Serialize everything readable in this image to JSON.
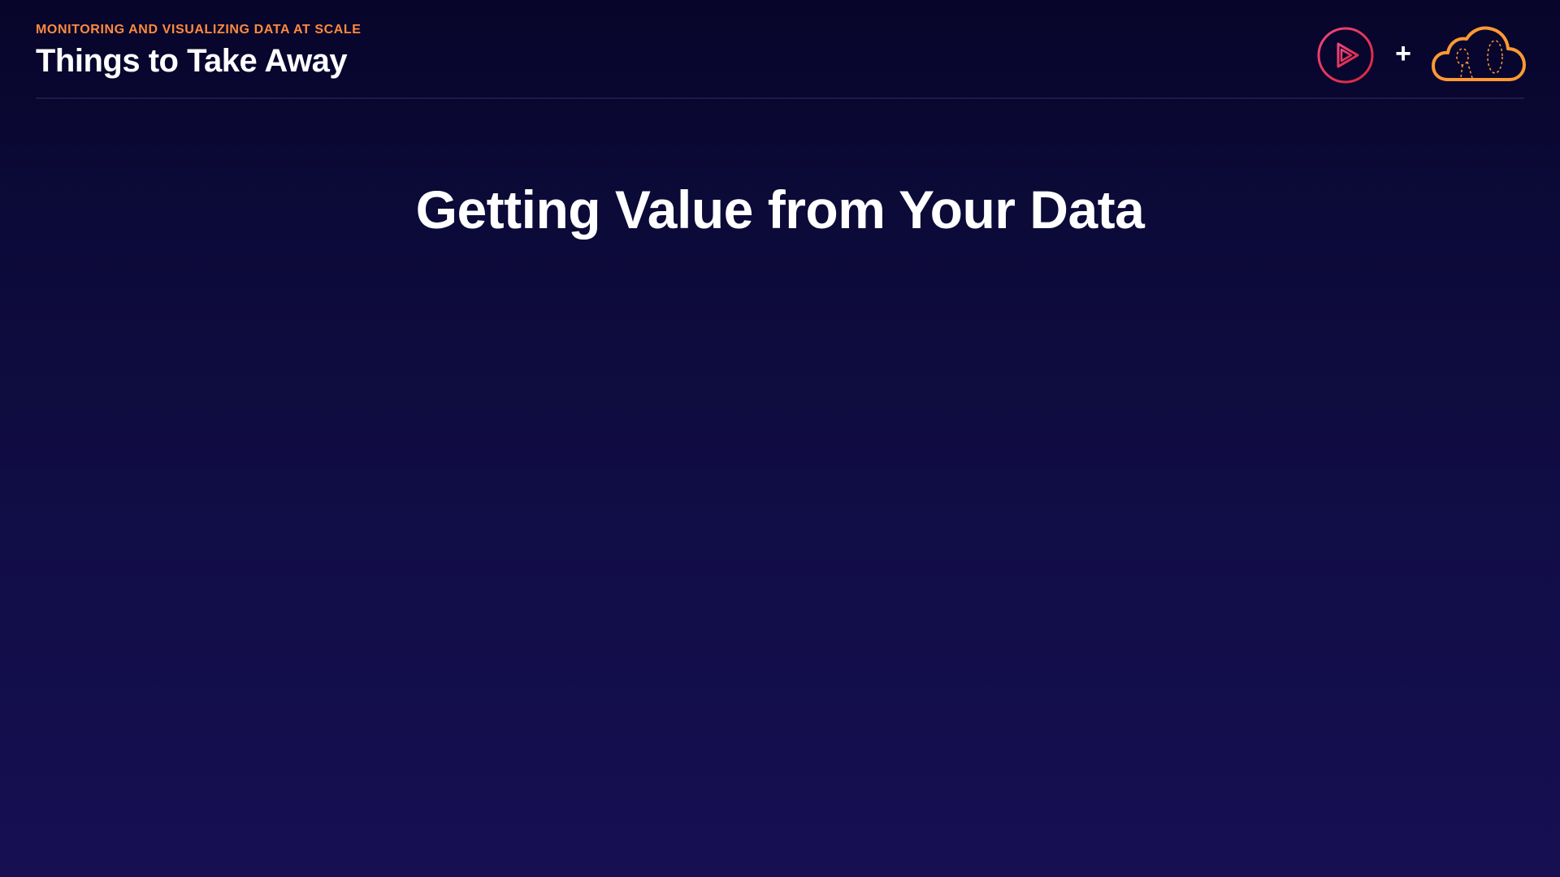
{
  "header": {
    "eyebrow": "MONITORING AND VISUALIZING DATA AT SCALE",
    "title": "Things to Take Away"
  },
  "logos": {
    "left_icon": "play-circle-icon",
    "separator": "+",
    "right_icon": "cloud-icon"
  },
  "main": {
    "heading": "Getting Value from Your Data"
  },
  "colors": {
    "background_top": "#07052a",
    "background_bottom": "#160f52",
    "accent_orange": "#ff8a3d",
    "accent_pink": "#e8305c",
    "text": "#ffffff"
  }
}
